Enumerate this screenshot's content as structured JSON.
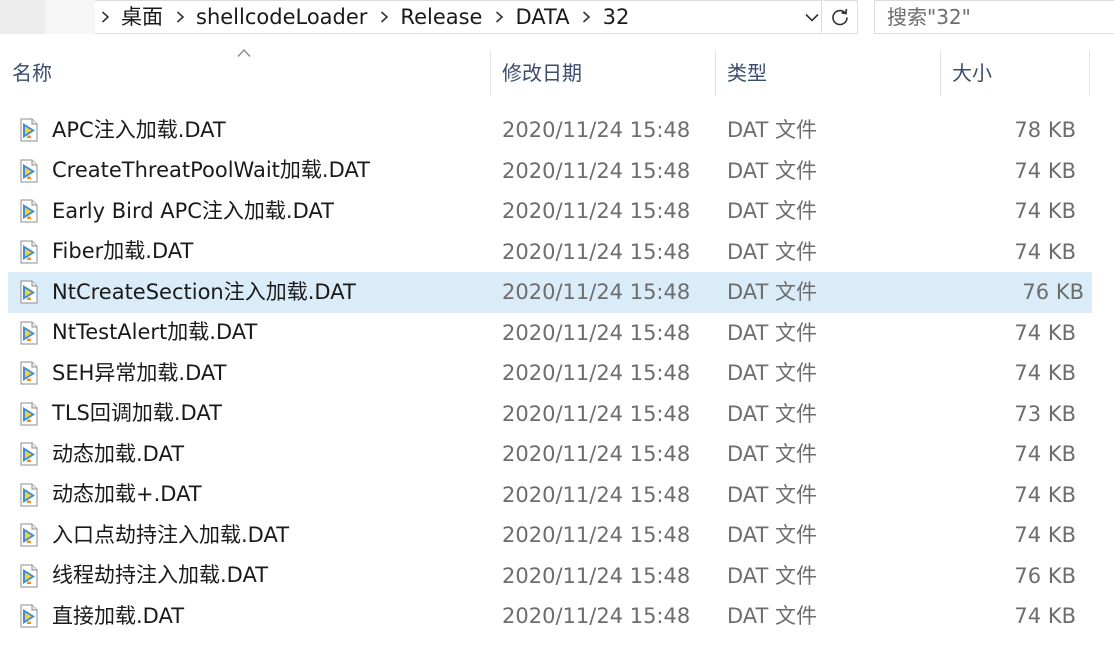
{
  "breadcrumb": {
    "items": [
      "桌面",
      "shellcodeLoader",
      "Release",
      "DATA",
      "32"
    ]
  },
  "search": {
    "placeholder": "搜索\"32\""
  },
  "columns": {
    "name": "名称",
    "date": "修改日期",
    "type": "类型",
    "size": "大小"
  },
  "colors": {
    "selected_row": "#d9ecf7",
    "header_text": "#3b4d6e",
    "secondary_text": "#6d6d6d"
  },
  "files": [
    {
      "name": "APC注入加载.DAT",
      "date": "2020/11/24 15:48",
      "type": "DAT 文件",
      "size": "78 KB",
      "icon": "vlc-file-icon"
    },
    {
      "name": "CreateThreatPoolWait加载.DAT",
      "date": "2020/11/24 15:48",
      "type": "DAT 文件",
      "size": "74 KB",
      "icon": "vlc-file-icon"
    },
    {
      "name": "Early Bird APC注入加载.DAT",
      "date": "2020/11/24 15:48",
      "type": "DAT 文件",
      "size": "74 KB",
      "icon": "vlc-file-icon"
    },
    {
      "name": "Fiber加载.DAT",
      "date": "2020/11/24 15:48",
      "type": "DAT 文件",
      "size": "74 KB",
      "icon": "vlc-file-icon"
    },
    {
      "name": "NtCreateSection注入加载.DAT",
      "date": "2020/11/24 15:48",
      "type": "DAT 文件",
      "size": "76 KB",
      "icon": "vlc-file-icon",
      "selected": true
    },
    {
      "name": "NtTestAlert加载.DAT",
      "date": "2020/11/24 15:48",
      "type": "DAT 文件",
      "size": "74 KB",
      "icon": "vlc-file-icon"
    },
    {
      "name": "SEH异常加载.DAT",
      "date": "2020/11/24 15:48",
      "type": "DAT 文件",
      "size": "74 KB",
      "icon": "vlc-file-icon"
    },
    {
      "name": "TLS回调加载.DAT",
      "date": "2020/11/24 15:48",
      "type": "DAT 文件",
      "size": "73 KB",
      "icon": "vlc-file-icon"
    },
    {
      "name": "动态加载.DAT",
      "date": "2020/11/24 15:48",
      "type": "DAT 文件",
      "size": "74 KB",
      "icon": "vlc-file-icon"
    },
    {
      "name": "动态加载+.DAT",
      "date": "2020/11/24 15:48",
      "type": "DAT 文件",
      "size": "74 KB",
      "icon": "vlc-file-icon"
    },
    {
      "name": "入口点劫持注入加载.DAT",
      "date": "2020/11/24 15:48",
      "type": "DAT 文件",
      "size": "74 KB",
      "icon": "vlc-file-icon"
    },
    {
      "name": "线程劫持注入加载.DAT",
      "date": "2020/11/24 15:48",
      "type": "DAT 文件",
      "size": "76 KB",
      "icon": "vlc-file-icon"
    },
    {
      "name": "直接加载.DAT",
      "date": "2020/11/24 15:48",
      "type": "DAT 文件",
      "size": "74 KB",
      "icon": "vlc-file-icon"
    }
  ]
}
